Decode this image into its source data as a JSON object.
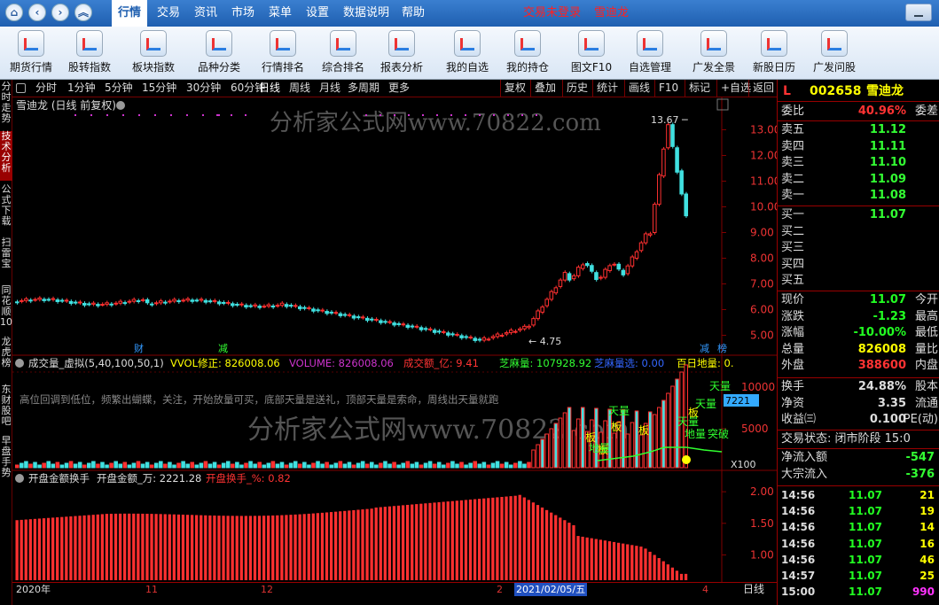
{
  "menubar": {
    "items": [
      "行情",
      "交易",
      "资讯",
      "市场",
      "菜单",
      "设置",
      "数据说明",
      "帮助"
    ],
    "active": 0,
    "login": "交易未登录",
    "stock": "雪迪龙"
  },
  "toolbar": {
    "items": [
      "期货行情",
      "股转指数",
      "板块指数",
      "品种分类",
      "行情排名",
      "综合排名",
      "报表分析",
      "我的自选",
      "我的持仓",
      "图文F10",
      "自选管理",
      "广发全景",
      "新股日历",
      "广发问股"
    ]
  },
  "leftnav": [
    {
      "label": "分时走势",
      "active": false
    },
    {
      "label": "技术分析",
      "active": true
    },
    {
      "label": "公式下载",
      "active": false
    },
    {
      "label": "扫雷宝",
      "active": false
    },
    {
      "label": "同花顺10",
      "active": false
    },
    {
      "label": "龙虎榜",
      "active": false
    },
    {
      "label": "东财股吧",
      "active": false
    },
    {
      "label": "早盘手势",
      "active": false
    }
  ],
  "periods": [
    "分时",
    "1分钟",
    "5分钟",
    "15分钟",
    "30分钟",
    "60分钟",
    "日线",
    "周线",
    "月线",
    "多周期",
    "更多"
  ],
  "period_selected": "日线",
  "righttools": [
    "复权",
    "叠加",
    "历史",
    "统计",
    "画线",
    "F10",
    "标记",
    "+自选",
    "返回"
  ],
  "main_chart": {
    "title": "雪迪龙 (日线 前复权)",
    "watermark": "分析家公式网www.70822.com",
    "high_label": "13.67",
    "low_label": "4.75",
    "yticks": [
      "13.00",
      "12.00",
      "11.00",
      "10.00",
      "9.00",
      "8.00",
      "7.00",
      "6.00",
      "5.00"
    ],
    "markers": [
      "财",
      "减",
      "减",
      "榜"
    ]
  },
  "vol_chart": {
    "title": "成交量_虚拟(5,40,100,50,1)",
    "vvol": "VVOL修正: 826008.06",
    "volume": "VOLUME: 826008.06",
    "amount": "成交额_亿: 9.41",
    "zhima": "芝麻量: 107928.92",
    "zhima_sel": "芝麻量选: 0.00",
    "baiyi": "百日地量: 0.",
    "note": "高位回调到低位，频繁出蝴蝶，关注，开始放量可买，底部天量是送礼，顶部天量是索命，周线出天量就跑",
    "yticks": [
      "10000",
      "5000"
    ],
    "last": "7221",
    "unit": "X100",
    "labels": [
      "天量",
      "板",
      "板",
      "地量",
      "板",
      "板",
      "天量",
      "天量",
      "天量",
      "板",
      "地量",
      "突破"
    ]
  },
  "open_chart": {
    "title": "开盘金额换手",
    "amount": "开盘金额_万: 2221.28",
    "turnover": "开盘换手_%: 0.82",
    "yticks": [
      "2.00",
      "1.50",
      "1.00"
    ]
  },
  "xaxis": {
    "dates": [
      "2020年",
      "11",
      "12",
      "2",
      "2021/02/05/五",
      "4"
    ],
    "mode": "日线"
  },
  "quote": {
    "flag": "L",
    "code": "002658",
    "name": "雪迪龙",
    "weibi_label": "委比",
    "weibi": "40.96%",
    "weicha": "委差",
    "asks": [
      {
        "l": "卖五",
        "p": "11.12"
      },
      {
        "l": "卖四",
        "p": "11.11"
      },
      {
        "l": "卖三",
        "p": "11.10"
      },
      {
        "l": "卖二",
        "p": "11.09"
      },
      {
        "l": "卖一",
        "p": "11.08"
      }
    ],
    "bids": [
      {
        "l": "买一",
        "p": "11.07"
      },
      {
        "l": "买二",
        "p": ""
      },
      {
        "l": "买三",
        "p": ""
      },
      {
        "l": "买四",
        "p": ""
      },
      {
        "l": "买五",
        "p": ""
      }
    ],
    "rows1": [
      {
        "l": "现价",
        "v": "11.07",
        "r": "今开",
        "c": "#2f2"
      },
      {
        "l": "涨跌",
        "v": "-1.23",
        "r": "最高",
        "c": "#2f2"
      },
      {
        "l": "涨幅",
        "v": "-10.00%",
        "r": "最低",
        "c": "#2f2"
      },
      {
        "l": "总量",
        "v": "826008",
        "r": "量比",
        "c": "#ff0"
      },
      {
        "l": "外盘",
        "v": "388600",
        "r": "内盘",
        "c": "#f33"
      }
    ],
    "rows2": [
      {
        "l": "换手",
        "v": "24.88%",
        "r": "股本",
        "c": "#ddd"
      },
      {
        "l": "净资",
        "v": "3.35",
        "r": "流通",
        "c": "#ddd"
      },
      {
        "l": "收益㈢",
        "v": "0.100",
        "r": "PE(动)",
        "c": "#ddd"
      }
    ],
    "state": "交易状态: 闭市阶段 15:0",
    "flows": [
      {
        "l": "净流入额",
        "v": "-547"
      },
      {
        "l": "大宗流入",
        "v": "-376"
      }
    ],
    "ticks": [
      {
        "t": "14:56",
        "p": "11.07",
        "v": "21"
      },
      {
        "t": "14:56",
        "p": "11.07",
        "v": "19"
      },
      {
        "t": "14:56",
        "p": "11.07",
        "v": "14"
      },
      {
        "t": "14:56",
        "p": "11.07",
        "v": "16"
      },
      {
        "t": "14:56",
        "p": "11.07",
        "v": "46"
      },
      {
        "t": "14:57",
        "p": "11.07",
        "v": "25"
      },
      {
        "t": "15:00",
        "p": "11.07",
        "v": "990"
      }
    ]
  },
  "colors": {
    "up": "#ff3030",
    "down": "#40e0e0",
    "green": "#30ff30",
    "yellow": "#ffff00",
    "grid": "#800000"
  }
}
